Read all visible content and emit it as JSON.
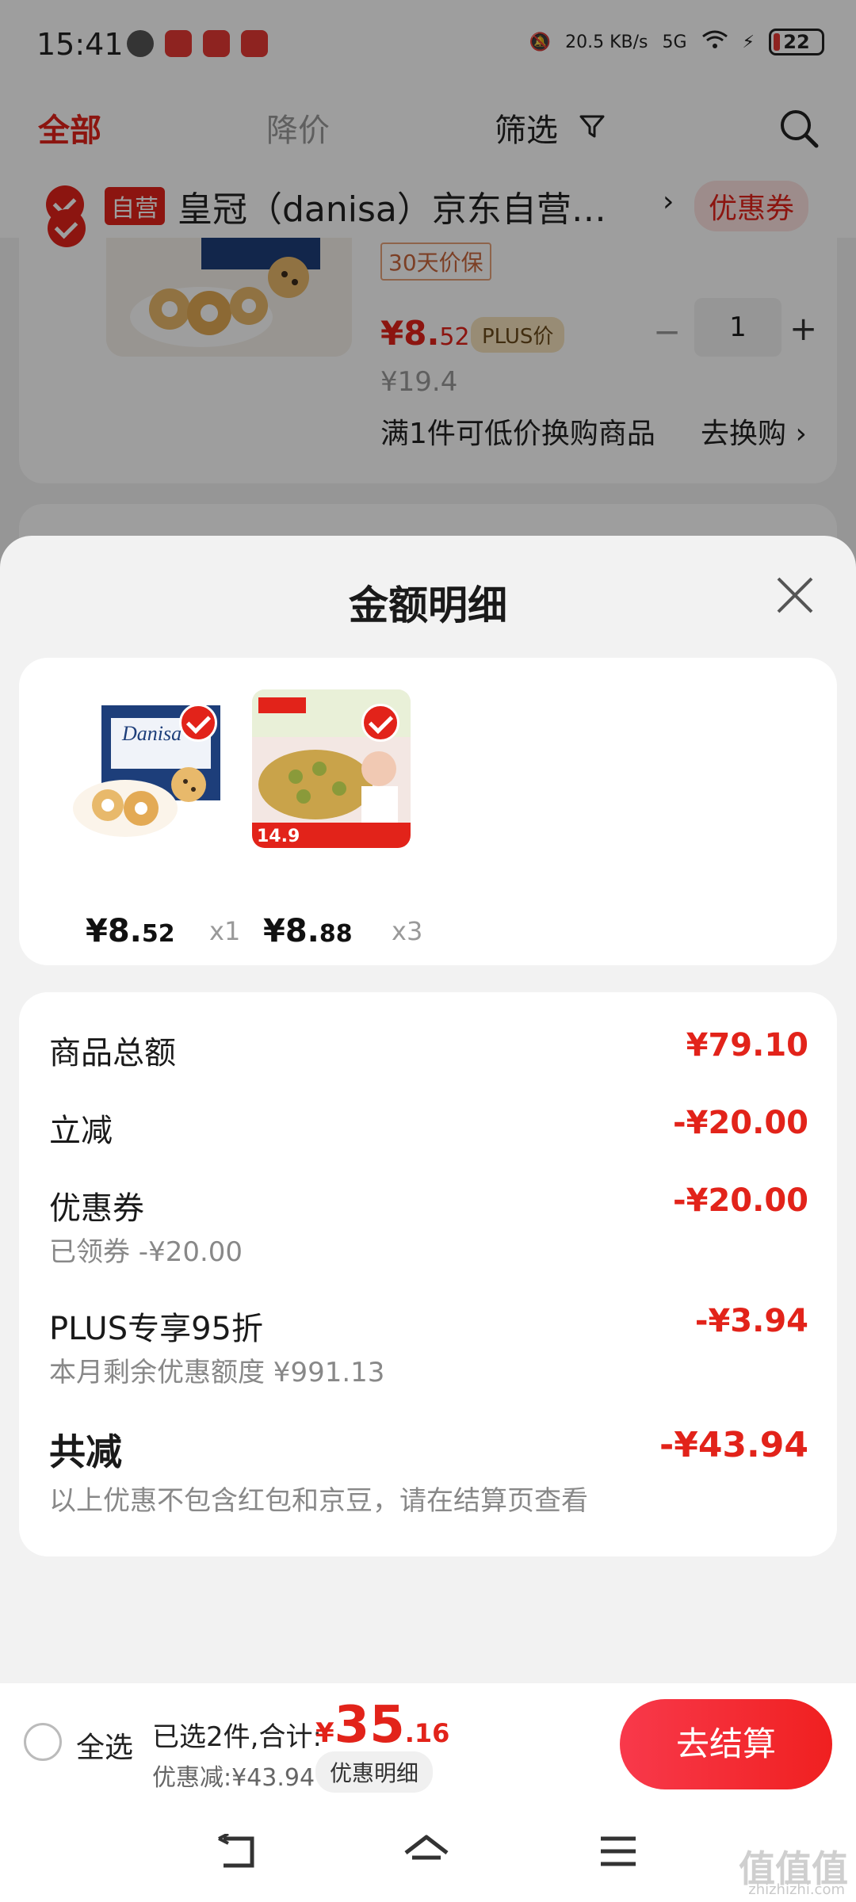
{
  "status_bar": {
    "time": "15:41",
    "net_speed": "20.5 KB/s",
    "network": "5G",
    "battery": "22"
  },
  "top_nav": {
    "tabs": [
      "全部",
      "降价",
      "筛选"
    ]
  },
  "shop": {
    "tag": "自营",
    "name": "皇冠（danisa）京东自营…",
    "arrow": "›",
    "coupon_label": "优惠券"
  },
  "background_product": {
    "guarantee_tag": "30天价保",
    "price_int": "¥8.",
    "price_frac": "52",
    "plus_tag": "PLUS价",
    "quantity": "1",
    "original_price": "¥19.4",
    "swap_text": "满1件可低价换购商品",
    "swap_link": "去换购 ›"
  },
  "sheet": {
    "title": "金额明细",
    "items": [
      {
        "price_int": "¥8.",
        "price_frac": "52",
        "qty": "x1"
      },
      {
        "price_int": "¥8.",
        "price_frac": "88",
        "qty": "x3"
      }
    ],
    "details": {
      "goods_total_label": "商品总额",
      "goods_total_value": "¥79.10",
      "instant_label": "立减",
      "instant_value": "-¥20.00",
      "coupon_label": "优惠券",
      "coupon_value": "-¥20.00",
      "coupon_sub": "已领券 -¥20.00",
      "plus_label": "PLUS专享95折",
      "plus_value": "-¥3.94",
      "plus_sub": "本月剩余优惠额度 ¥991.13",
      "total_label": "共减",
      "total_value": "-¥43.94",
      "total_sub": "以上优惠不包含红包和京豆，请在结算页查看"
    }
  },
  "checkout": {
    "select_all": "全选",
    "selected_text": "已选2件,合计:",
    "total_symbol": "¥",
    "total_int": "35",
    "total_frac": ".16",
    "discount_text": "优惠减:¥43.94",
    "detail_button": "优惠明细",
    "checkout_button": "去结算"
  },
  "watermark": {
    "text": "值值值",
    "sub": "zhizhizhi.com"
  },
  "colors": {
    "brand_red": "#e2231a",
    "sheet_bg": "#f2f2f2"
  }
}
